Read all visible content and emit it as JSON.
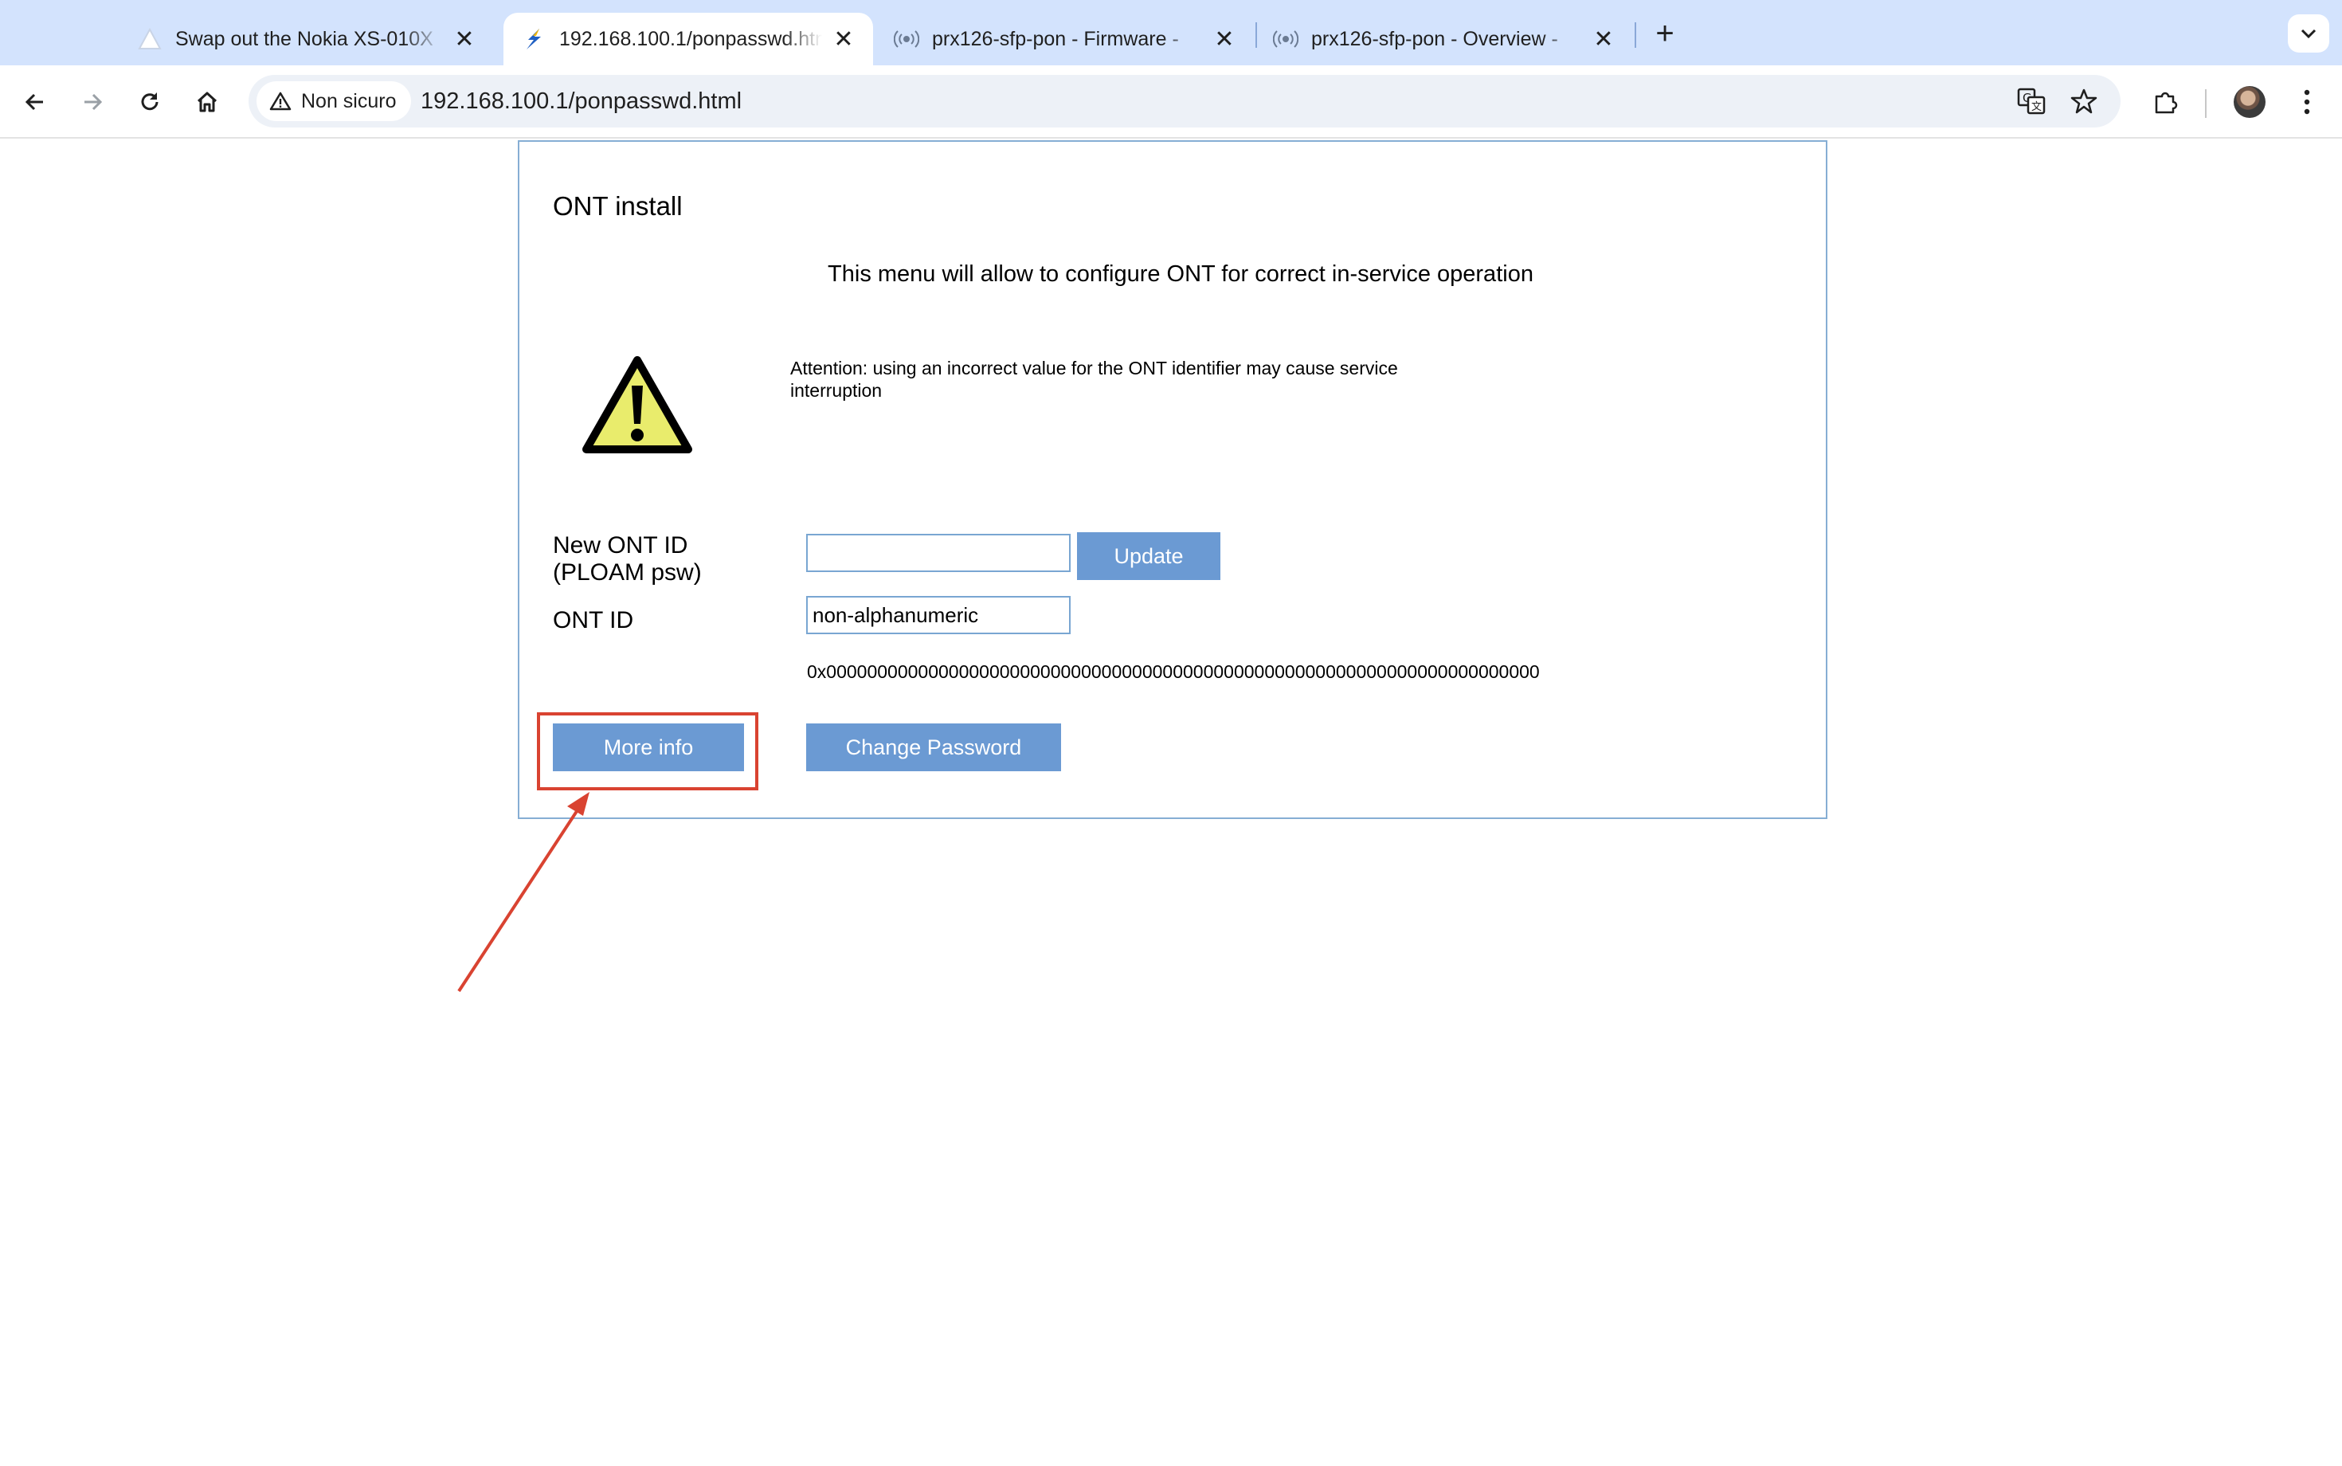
{
  "browser": {
    "tabs": [
      {
        "title": "Swap out the Nokia XS-010X",
        "favicon": "triangle-logo-icon",
        "active": false
      },
      {
        "title": "192.168.100.1/ponpasswd.html",
        "favicon": "lightning-logo-icon",
        "active": true
      },
      {
        "title": "prx126-sfp-pon - Firmware -",
        "favicon": "broadcast-icon",
        "active": false
      },
      {
        "title": "prx126-sfp-pon - Overview -",
        "favicon": "broadcast-icon",
        "active": false
      }
    ],
    "security_label": "Non sicuro",
    "url": "192.168.100.1/ponpasswd.html"
  },
  "page": {
    "title": "ONT install",
    "subtitle": "This menu will allow to configure ONT for correct in-service operation",
    "attention": "Attention: using an incorrect value for the ONT identifier may cause service interruption",
    "new_ont_label": "New ONT ID (PLOAM psw)",
    "new_ont_value": "",
    "update_label": "Update",
    "ont_id_label": "ONT ID",
    "ont_id_value": "non-alphanumeric",
    "ont_hex": "0x0000000000000000000000000000000000000000000000000000000000000000000000",
    "more_info_label": "More info",
    "change_password_label": "Change Password"
  },
  "annotation": {
    "color": "#d94331"
  }
}
